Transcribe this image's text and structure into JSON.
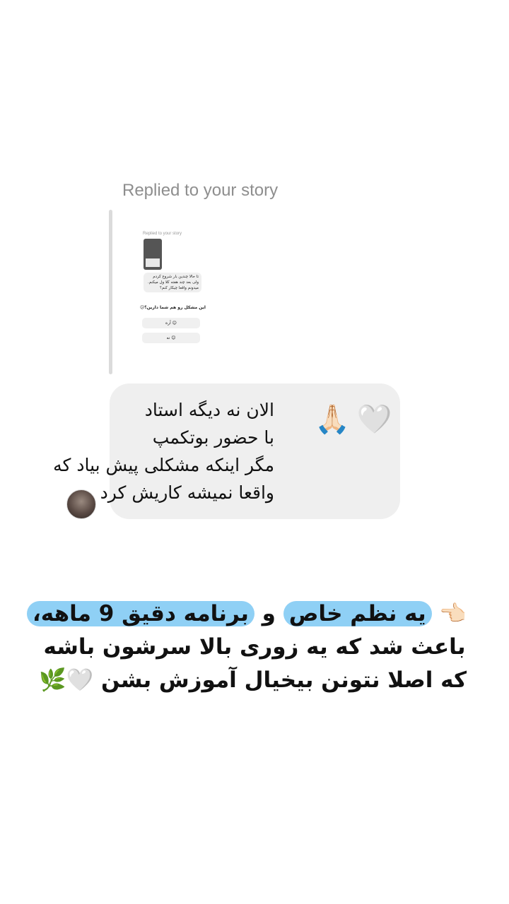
{
  "replied_label": "Replied to your story",
  "story_preview": {
    "replied_label": "Replied to your story",
    "reply_text": "تا حالا چندین بار شروع کردم ولی بعد چند هفته کلا ول میکنم. میدونم واقعا چیکار کنم؟",
    "question": "این مشکل رو هم شما دارین؟😕",
    "options": [
      "آره 😊",
      "نه 😊"
    ]
  },
  "message": {
    "lines": [
      "الان نه دیگه استاد",
      "با حضور بوتکمپ",
      "مگر اینکه مشکلی پیش بیاد که",
      "واقعا نمیشه کاریش کرد"
    ],
    "emoji": "🙏🏻🤍"
  },
  "caption": {
    "pointer": "👈🏻",
    "highlight_1": "یه نظم خاص",
    "connector": " و ",
    "highlight_2": "برنامه دقیق 9 ماهه،",
    "line2": "باعث شد که یه زوری بالا سرشون باشه",
    "line3": "که اصلا نتونن بیخیال آموزش بشن 🤍🌿"
  }
}
